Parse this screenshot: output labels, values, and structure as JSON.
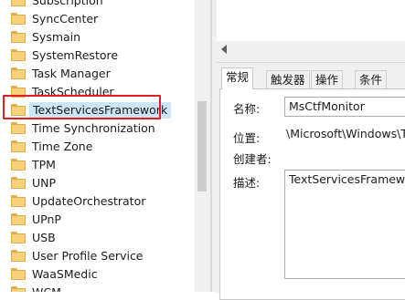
{
  "tree": {
    "items": [
      {
        "label": "Subscription",
        "selected": false
      },
      {
        "label": "SyncCenter",
        "selected": false
      },
      {
        "label": "Sysmain",
        "selected": false
      },
      {
        "label": "SystemRestore",
        "selected": false
      },
      {
        "label": "Task Manager",
        "selected": false
      },
      {
        "label": "TaskScheduler",
        "selected": false
      },
      {
        "label": "TextServicesFramework",
        "selected": true
      },
      {
        "label": "Time Synchronization",
        "selected": false
      },
      {
        "label": "Time Zone",
        "selected": false
      },
      {
        "label": "TPM",
        "selected": false
      },
      {
        "label": "UNP",
        "selected": false
      },
      {
        "label": "UpdateOrchestrator",
        "selected": false
      },
      {
        "label": "UPnP",
        "selected": false
      },
      {
        "label": "USB",
        "selected": false
      },
      {
        "label": "User Profile Service",
        "selected": false
      },
      {
        "label": "WaaSMedic",
        "selected": false
      },
      {
        "label": "WCM",
        "selected": false
      }
    ],
    "folder_icon": "folder-icon",
    "highlight_color": "#e02020",
    "selection_color": "#cde6f7"
  },
  "details": {
    "tabs": [
      {
        "label": "常规",
        "active": true
      },
      {
        "label": "触发器",
        "active": false
      },
      {
        "label": "操作",
        "active": false
      },
      {
        "label": "条件",
        "active": false
      }
    ],
    "fields": {
      "name_label": "名称:",
      "name_value": "MsCtfMonitor",
      "location_label": "位置:",
      "location_value": "\\Microsoft\\Windows\\TextServicesFramework",
      "author_label": "创建者:",
      "author_value": "",
      "description_label": "描述:",
      "description_value": "TextServicesFramework monitor task"
    }
  }
}
